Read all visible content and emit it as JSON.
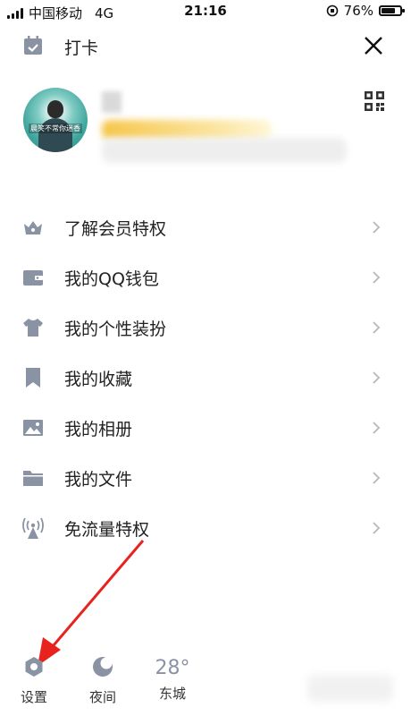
{
  "status_bar": {
    "carrier": "中国移动",
    "network": "4G",
    "time": "21:16",
    "battery": "76%",
    "battery_level": 0.76
  },
  "header": {
    "checkin_label": "打卡",
    "checkin_icon": "calendar-check-icon",
    "close_icon": "close-icon"
  },
  "profile": {
    "avatar_caption": "晨笑不常你迷香",
    "qr_icon": "qr-code-icon"
  },
  "menu": {
    "items": [
      {
        "label": "了解会员特权",
        "icon": "crown-icon"
      },
      {
        "label": "我的QQ钱包",
        "icon": "wallet-icon"
      },
      {
        "label": "我的个性装扮",
        "icon": "tshirt-icon"
      },
      {
        "label": "我的收藏",
        "icon": "bookmark-icon"
      },
      {
        "label": "我的相册",
        "icon": "photo-icon"
      },
      {
        "label": "我的文件",
        "icon": "folder-icon"
      },
      {
        "label": "免流量特权",
        "icon": "signal-tower-icon"
      }
    ]
  },
  "bottom_bar": {
    "settings_label": "设置",
    "night_label": "夜间",
    "weather_temp": "28°",
    "weather_city": "东城"
  },
  "colors": {
    "icon": "#8a93a4",
    "arrow": "#e8231e",
    "text": "#222222"
  }
}
